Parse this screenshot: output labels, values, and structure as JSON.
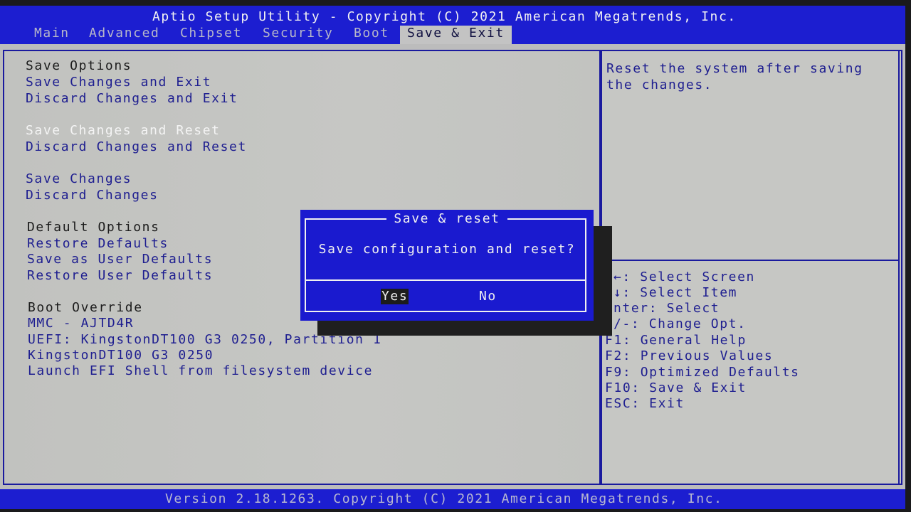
{
  "header": {
    "title": "Aptio Setup Utility - Copyright (C) 2021 American Megatrends, Inc.",
    "tabs": [
      {
        "label": "Main",
        "active": false
      },
      {
        "label": "Advanced",
        "active": false
      },
      {
        "label": "Chipset",
        "active": false
      },
      {
        "label": "Security",
        "active": false
      },
      {
        "label": "Boot",
        "active": false
      },
      {
        "label": "Save & Exit",
        "active": true
      }
    ]
  },
  "menu": {
    "save_options": {
      "heading": "Save Options",
      "items": [
        "Save Changes and Exit",
        "Discard Changes and Exit",
        "Save Changes and Reset",
        "Discard Changes and Reset",
        "Save Changes",
        "Discard Changes"
      ]
    },
    "default_options": {
      "heading": "Default Options",
      "items": [
        "Restore Defaults",
        "Save as User Defaults",
        "Restore User Defaults"
      ]
    },
    "boot_override": {
      "heading": "Boot Override",
      "items": [
        "MMC - AJTD4R",
        "UEFI: KingstonDT100 G3 0250, Partition 1",
        "KingstonDT100 G3 0250",
        "Launch EFI Shell from filesystem device"
      ]
    },
    "selected_item": "Save Changes and Reset"
  },
  "help": {
    "description": [
      "Reset the system after saving",
      "the changes."
    ],
    "keys": [
      "←: Select Screen",
      "↓: Select Item",
      "nter: Select",
      "/-: Change Opt.",
      "F1: General Help",
      "F2: Previous Values",
      "F9: Optimized Defaults",
      "F10: Save & Exit",
      "ESC: Exit"
    ]
  },
  "dialog": {
    "title": "Save & reset",
    "message": "Save configuration and reset?",
    "buttons": [
      {
        "label": "Yes",
        "focused": true
      },
      {
        "label": "No",
        "focused": false
      }
    ]
  },
  "footer": {
    "text": "Version 2.18.1263. Copyright (C) 2021 American Megatrends, Inc."
  },
  "colors": {
    "bios_blue": "#1c1ed0",
    "panel_gray": "#c4c4c2",
    "item_blue": "#1e1e90",
    "selected_white": "#f4f4f4"
  }
}
